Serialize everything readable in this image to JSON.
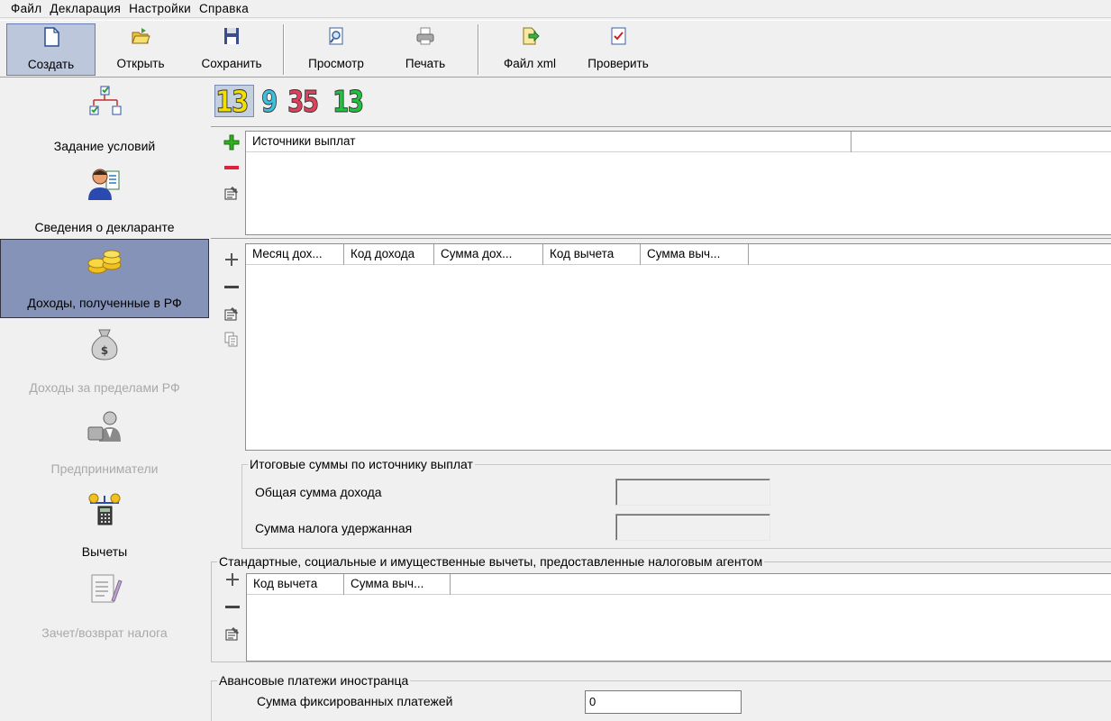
{
  "menu": {
    "items": [
      "Файл",
      "Декларация",
      "Настройки",
      "Справка"
    ]
  },
  "toolbar": {
    "create": "Создать",
    "open": "Открыть",
    "save": "Сохранить",
    "preview": "Просмотр",
    "print": "Печать",
    "xml": "Файл xml",
    "check": "Проверить"
  },
  "sidebar": {
    "items": [
      {
        "label": "Задание условий",
        "icon": "tree-checklist-icon"
      },
      {
        "label": "Сведения о декларанте",
        "icon": "person-document-icon"
      },
      {
        "label": "Доходы, полученные в РФ",
        "icon": "coins-icon"
      },
      {
        "label": "Доходы за пределами РФ",
        "icon": "money-bag-icon"
      },
      {
        "label": "Предприниматели",
        "icon": "businessman-icon"
      },
      {
        "label": "Вычеты",
        "icon": "scales-calculator-icon"
      },
      {
        "label": "Зачет/возврат налога",
        "icon": "document-pen-icon"
      }
    ]
  },
  "badges": [
    {
      "value": "13",
      "color": "#f4e000"
    },
    {
      "value": "9",
      "color": "#3cc0e0"
    },
    {
      "value": "35",
      "color": "#e0405a"
    },
    {
      "value": "13",
      "color": "#20c040"
    }
  ],
  "sources": {
    "header": "Источники выплат"
  },
  "income": {
    "columns": [
      "Месяц дох...",
      "Код дохода",
      "Сумма дох...",
      "Код вычета",
      "Сумма выч..."
    ]
  },
  "totals": {
    "title": "Итоговые суммы по источнику выплат",
    "total_income_label": "Общая сумма дохода",
    "tax_withheld_label": "Сумма налога удержанная"
  },
  "deductions": {
    "title": "Стандартные, социальные и имущественные вычеты, предоставленные налоговым агентом",
    "columns": [
      "Код вычета",
      "Сумма выч..."
    ]
  },
  "advance": {
    "title": "Авансовые платежи иностранца",
    "fixed_label": "Сумма фиксированных платежей",
    "fixed_value": "0"
  }
}
